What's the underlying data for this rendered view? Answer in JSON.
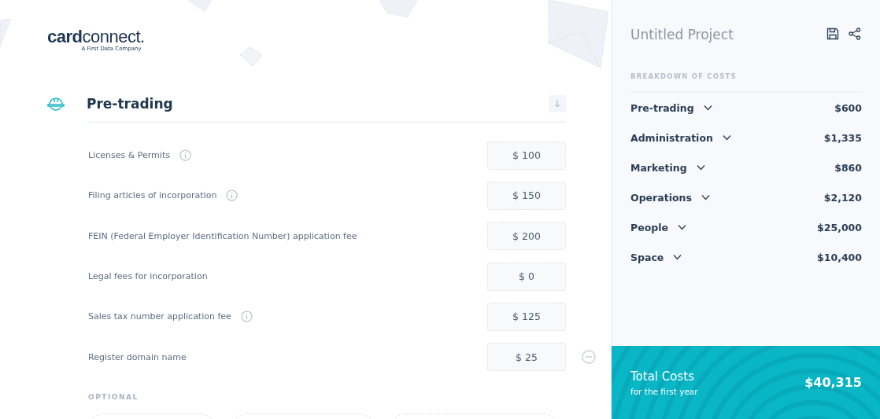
{
  "logo": {
    "name": "**card**connect.",
    "tagline": "A First Data Company"
  },
  "section": {
    "title": "Pre-trading",
    "items": [
      {
        "label": "Licenses & Permits",
        "value": "$ 100",
        "info": true,
        "removable": false
      },
      {
        "label": "Filing articles of incorporation",
        "value": "$ 150",
        "info": true,
        "removable": false
      },
      {
        "label": "FEIN (Federal Employer Identification Number) application fee",
        "value": "$ 200",
        "info": false,
        "removable": false
      },
      {
        "label": "Legal fees for incorporation",
        "value": "$ 0",
        "info": false,
        "removable": false
      },
      {
        "label": "Sales tax number application fee",
        "value": "$ 125",
        "info": true,
        "removable": false
      },
      {
        "label": "Register domain name",
        "value": "$ 25",
        "info": false,
        "removable": true
      }
    ],
    "optional_label": "OPTIONAL"
  },
  "summary": {
    "title": "Untitled Project",
    "heading": "BREAKDOWN OF COSTS",
    "categories": [
      {
        "name": "Pre-trading",
        "amount": "$600",
        "expanded": false
      },
      {
        "name": "Administration",
        "amount": "$1,335",
        "expanded": false
      },
      {
        "name": "Marketing",
        "amount": "$860",
        "expanded": false
      },
      {
        "name": "Operations",
        "amount": "$2,120",
        "expanded": false
      },
      {
        "name": "People",
        "amount": "$25,000",
        "expanded": false
      },
      {
        "name": "Space",
        "amount": "$10,400",
        "expanded": false
      }
    ],
    "total_label": "Total Costs",
    "total_sub": "for the first year",
    "total": "$40,315"
  }
}
